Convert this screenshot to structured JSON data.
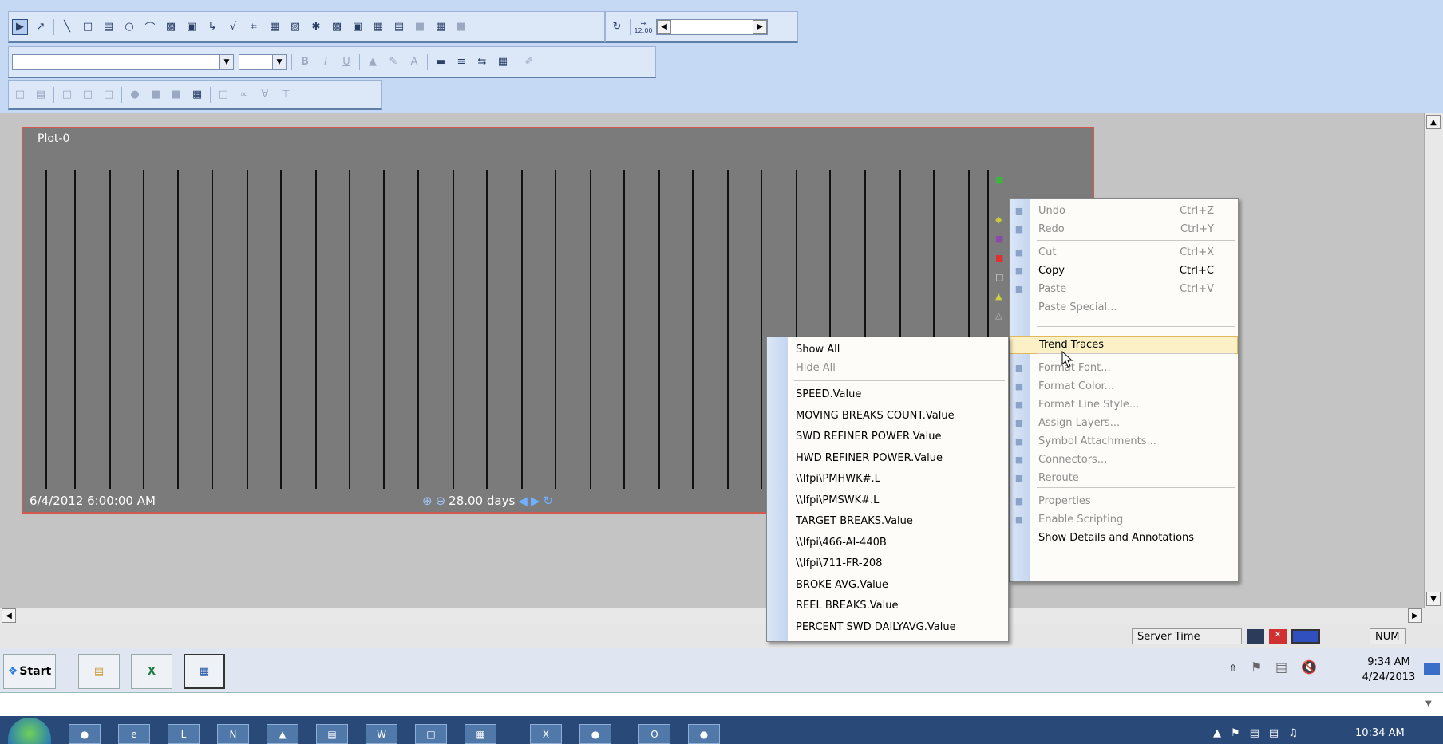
{
  "plot": {
    "title": "Plot-0",
    "start_time": "6/4/2012 6:00:00 AM",
    "time_span": "28.00 days"
  },
  "context_menu": {
    "items": [
      {
        "label": "Undo",
        "shortcut": "Ctrl+Z",
        "enabled": false
      },
      {
        "label": "Redo",
        "shortcut": "Ctrl+Y",
        "enabled": false
      },
      {
        "label": "Cut",
        "shortcut": "Ctrl+X",
        "enabled": false
      },
      {
        "label": "Copy",
        "shortcut": "Ctrl+C",
        "enabled": true
      },
      {
        "label": "Paste",
        "shortcut": "Ctrl+V",
        "enabled": false
      },
      {
        "label": "Paste Special...",
        "shortcut": "",
        "enabled": false
      },
      {
        "label": "Trend Traces",
        "shortcut": "",
        "enabled": true,
        "highlighted": true
      },
      {
        "label": "Format Font...",
        "shortcut": "",
        "enabled": false
      },
      {
        "label": "Format Color...",
        "shortcut": "",
        "enabled": false
      },
      {
        "label": "Format Line Style...",
        "shortcut": "",
        "enabled": false
      },
      {
        "label": "Assign Layers...",
        "shortcut": "",
        "enabled": false
      },
      {
        "label": "Symbol Attachments...",
        "shortcut": "",
        "enabled": false
      },
      {
        "label": "Connectors...",
        "shortcut": "",
        "enabled": false
      },
      {
        "label": "Reroute",
        "shortcut": "",
        "enabled": false
      },
      {
        "label": "Properties",
        "shortcut": "",
        "enabled": false
      },
      {
        "label": "Enable Scripting",
        "shortcut": "",
        "enabled": false
      },
      {
        "label": "Show Details and Annotations",
        "shortcut": "",
        "enabled": true
      }
    ]
  },
  "traces_submenu": {
    "items": [
      {
        "label": "Show All",
        "enabled": true
      },
      {
        "label": "Hide All",
        "enabled": false
      },
      {
        "label": "SPEED.Value",
        "enabled": true
      },
      {
        "label": "MOVING BREAKS COUNT.Value",
        "enabled": true
      },
      {
        "label": "SWD REFINER POWER.Value",
        "enabled": true
      },
      {
        "label": "HWD REFINER POWER.Value",
        "enabled": true
      },
      {
        "label": "\\\\Ifpi\\PMHWK#.L",
        "enabled": true
      },
      {
        "label": "\\\\Ifpi\\PMSWK#.L",
        "enabled": true
      },
      {
        "label": "TARGET BREAKS.Value",
        "enabled": true
      },
      {
        "label": "\\\\Ifpi\\466-AI-440B",
        "enabled": true
      },
      {
        "label": "\\\\Ifpi\\711-FR-208",
        "enabled": true
      },
      {
        "label": "BROKE AVG.Value",
        "enabled": true
      },
      {
        "label": "REEL BREAKS.Value",
        "enabled": true
      },
      {
        "label": "PERCENT SWD DAILYAVG.Value",
        "enabled": true
      }
    ]
  },
  "statusbar": {
    "server_time_label": "Server Time",
    "num_indicator": "NUM"
  },
  "taskbar": {
    "start_label": "Start",
    "clock_time": "9:34 AM",
    "clock_date": "4/24/2013",
    "outer_clock_time": "10:34 AM"
  },
  "toolbar": {
    "time_label": "12:00"
  }
}
